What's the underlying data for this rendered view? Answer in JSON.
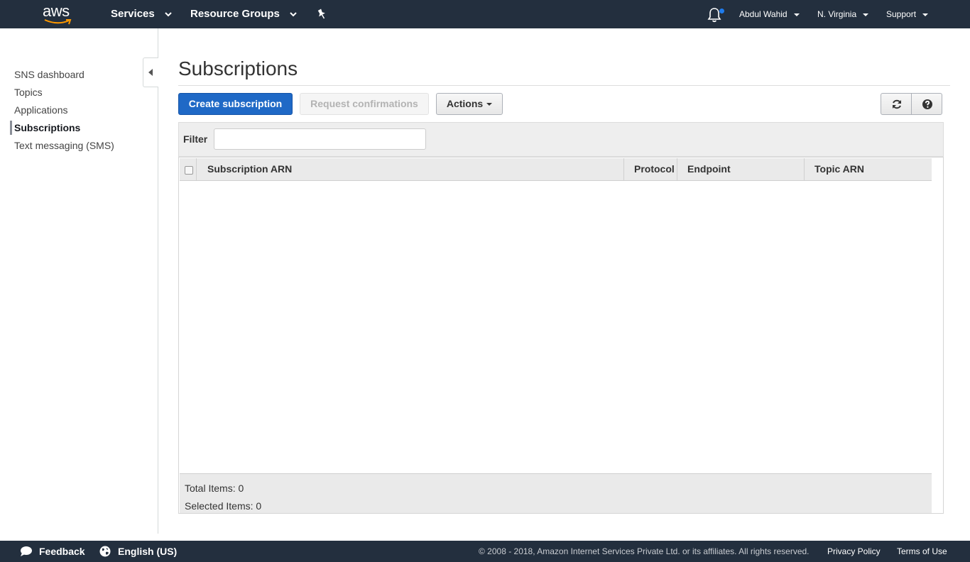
{
  "topnav": {
    "logo_text": "aws",
    "services": "Services",
    "resource_groups": "Resource Groups",
    "account": "Abdul Wahid",
    "region": "N. Virginia",
    "support": "Support",
    "notification_dot_color": "#1f7ced"
  },
  "sidebar": {
    "items": [
      {
        "label": "SNS dashboard",
        "active": false
      },
      {
        "label": "Topics",
        "active": false
      },
      {
        "label": "Applications",
        "active": false
      },
      {
        "label": "Subscriptions",
        "active": true
      },
      {
        "label": "Text messaging (SMS)",
        "active": false
      }
    ]
  },
  "main": {
    "title": "Subscriptions",
    "buttons": {
      "create": "Create subscription",
      "request": "Request confirmations",
      "actions": "Actions"
    },
    "filter": {
      "label": "Filter",
      "value": ""
    },
    "table": {
      "columns": [
        "Subscription ARN",
        "Protocol",
        "Endpoint",
        "Topic ARN"
      ],
      "rows": [],
      "total_items": "Total Items: 0",
      "selected_items": "Selected Items: 0"
    }
  },
  "footer": {
    "feedback": "Feedback",
    "language": "English (US)",
    "copyright": "© 2008 - 2018, Amazon Internet Services Private Ltd. or its affiliates. All rights reserved.",
    "privacy": "Privacy Policy",
    "terms": "Terms of Use"
  },
  "colors": {
    "nav_bg": "#232f3e",
    "primary_button": "#1f69c6"
  },
  "icons": [
    "aws-smile-logo",
    "chevron-down-icon",
    "pin-icon",
    "bell-icon",
    "collapse-arrow-icon",
    "refresh-icon",
    "help-icon",
    "speech-bubble-icon",
    "globe-icon"
  ]
}
